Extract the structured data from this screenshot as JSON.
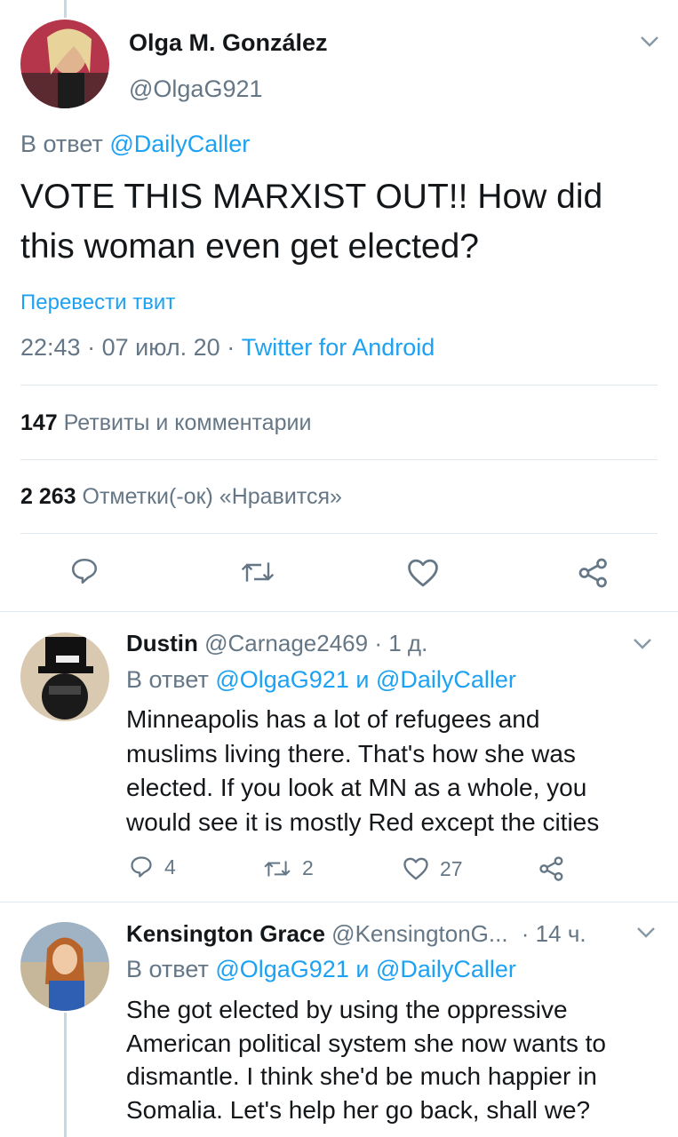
{
  "main_tweet": {
    "name": "Olga M. González",
    "handle": "@OlgaG921",
    "reply_prefix": "В ответ",
    "reply_to": "@DailyCaller",
    "text_line1": "VOTE THIS MARXIST OUT!! How did",
    "text_line2": "this woman even get elected?",
    "translate": "Перевести твит",
    "time": "22:43",
    "sep1": "·",
    "date": "07 июл. 20",
    "sep2": "·",
    "source": "Twitter for Android",
    "retweets_count": "147",
    "retweets_label": "Ретвиты и комментарии",
    "likes_count": "2 263",
    "likes_label": "Отметки(-ок) «Нравится»"
  },
  "replies": [
    {
      "name": "Dustin",
      "handle": "@Carnage2469",
      "time": "· 1 д.",
      "reply_prefix": "В ответ",
      "mention1": "@OlgaG921",
      "and": "и",
      "mention2": "@DailyCaller",
      "lines": [
        "Minneapolis has a lot of refugees and",
        "muslims living there. That's how she was",
        "elected. If you look at MN as a whole, you",
        "would see it is mostly Red except the cities"
      ],
      "replies_count": "4",
      "retweets_count": "2",
      "likes_count": "27"
    },
    {
      "name": "Kensington Grace",
      "handle": "@KensingtonG...",
      "time": "· 14 ч.",
      "reply_prefix": "В ответ",
      "mention1": "@OlgaG921",
      "and": "и",
      "mention2": "@DailyCaller",
      "lines": [
        "She got elected by using the oppressive",
        "American political system she now wants to",
        "dismantle. I think she'd be much happier in",
        "Somalia. Let's help her go back, shall we?"
      ]
    }
  ],
  "colors": {
    "link": "#1da1f2",
    "muted": "#657786",
    "text": "#14171a",
    "divider": "#e1e8ed"
  }
}
